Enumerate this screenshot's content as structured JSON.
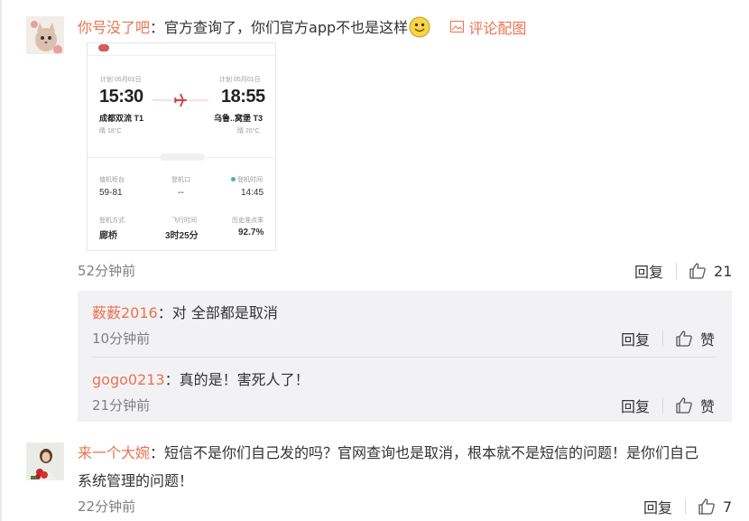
{
  "comments": [
    {
      "user": "你号没了吧",
      "text": "：官方查询了，你们官方app不也是这样",
      "emoji": "smile-emoji",
      "pic_link": "评论配图",
      "time": "52分钟前",
      "reply_label": "回复",
      "like_count": "21",
      "flight_card": {
        "dep_label": "计划 05月01日",
        "arr_label": "计划 05月01日",
        "dep_time": "15:30",
        "arr_time": "18:55",
        "dep_airport": "成都双流 T1",
        "arr_airport": "乌鲁..窝堡 T3",
        "dep_weather": "晴 18°C",
        "arr_weather": "晴 20°C",
        "f1_label": "值机柜台",
        "f1_value": "59-81",
        "f2_label": "登机口",
        "f2_value": "--",
        "f3_label": "登机时间",
        "f3_value": "14:45",
        "f4_label": "登机方式",
        "f4_value": "廊桥",
        "f5_label": "飞行时间",
        "f5_value": "3时25分",
        "f6_label": "历史准点率",
        "f6_value": "92.7%"
      }
    },
    {
      "user": "来一个大婉",
      "text_line1": "：短信不是你们自己发的吗？官网查询也是取消，根本就不是短信的问题！是你们自己",
      "text_line2": "系统管理的问题！",
      "time": "22分钟前",
      "reply_label": "回复",
      "like_count": "7"
    }
  ],
  "replies": [
    {
      "user": "薮薮2016",
      "text": "：对 全部都是取消",
      "time": "10分钟前",
      "reply_label": "回复",
      "like_label": "赞"
    },
    {
      "user": "gogo0213",
      "text": "：真的是！害死人了！",
      "time": "21分钟前",
      "reply_label": "回复",
      "like_label": "赞"
    }
  ],
  "colors": {
    "username": "#eb7350",
    "pic_link": "#eb7350",
    "reply_bg": "#f2f2f5",
    "time": "#808080"
  }
}
